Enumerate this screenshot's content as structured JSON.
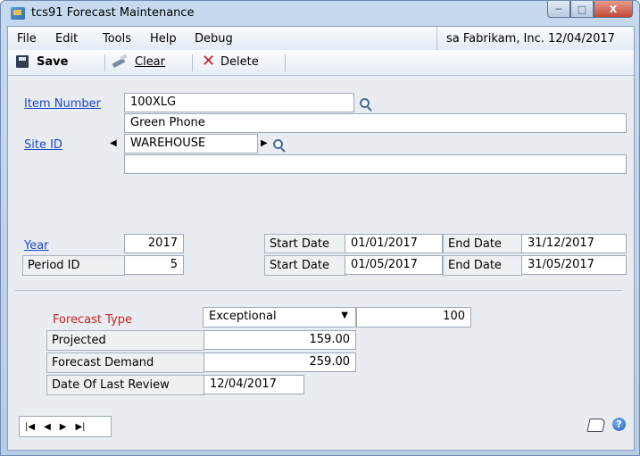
{
  "window": {
    "title": "tcs91 Forecast Maintenance",
    "controls": {
      "minimize": "─",
      "maximize": "□",
      "close": "X"
    }
  },
  "menu": {
    "items": [
      "File",
      "Edit",
      "Tools",
      "Help",
      "Debug"
    ],
    "company": "sa  Fabrikam, Inc. 12/04/2017"
  },
  "toolbar": {
    "save_label": "Save",
    "clear_label": "Clear",
    "delete_label": "Delete"
  },
  "form": {
    "item_number_label": "Item Number",
    "item_number_value": "100XLG",
    "item_description": "Green Phone",
    "site_id_label": "Site ID",
    "site_id_value": "WAREHOUSE",
    "site_description": "",
    "year_label": "Year",
    "year_value": "2017",
    "year_start_label": "Start Date",
    "year_start_value": "01/01/2017",
    "year_end_label": "End Date",
    "year_end_value": "31/12/2017",
    "period_label": "Period ID",
    "period_value": "5",
    "period_start_label": "Start Date",
    "period_start_value": "01/05/2017",
    "period_end_label": "End Date",
    "period_end_value": "31/05/2017"
  },
  "forecast": {
    "type_label": "Forecast Type",
    "type_value": "Exceptional",
    "type_amount": "100",
    "projected_label": "Projected",
    "projected_value": "159.00",
    "demand_label": "Forecast Demand",
    "demand_value": "259.00",
    "review_label": "Date Of Last Review",
    "review_value": "12/04/2017"
  },
  "footer": {
    "nav": {
      "first": "|◀",
      "prev": "◀",
      "next": "▶",
      "last": "▶|"
    },
    "icons": [
      "note-icon",
      "help-icon"
    ]
  }
}
